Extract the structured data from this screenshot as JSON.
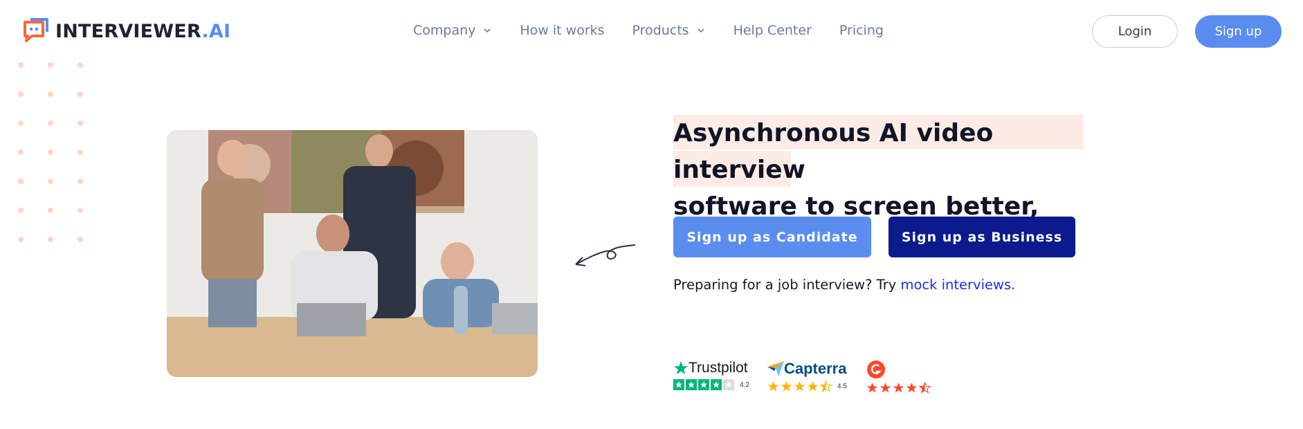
{
  "brand": {
    "name_main": "INTERVIEWER",
    "name_suffix": ".AI",
    "logo_icon": "chat-bubble-icon",
    "accent_color": "#5b8def",
    "logo_orange": "#f26a3d"
  },
  "nav": {
    "items": [
      {
        "label": "Company",
        "has_dropdown": true
      },
      {
        "label": "How it works",
        "has_dropdown": false
      },
      {
        "label": "Products",
        "has_dropdown": true
      },
      {
        "label": "Help Center",
        "has_dropdown": false
      },
      {
        "label": "Pricing",
        "has_dropdown": false
      }
    ],
    "login_label": "Login",
    "signup_label": "Sign up"
  },
  "hero": {
    "headline_line1": "Asynchronous AI video interview",
    "headline_line2_highlight": "software",
    "headline_line2_rest": " to screen better, faster.",
    "candidate_button": "Sign up as Candidate",
    "business_button": "Sign up as Business",
    "mock_prefix": "Preparing for a job interview? Try ",
    "mock_link": "mock interviews.",
    "highlight_color": "#fdece6",
    "business_color": "#0b1a8c"
  },
  "ratings": {
    "trustpilot": {
      "name": "Trustpilot",
      "score": "4.2",
      "stars": 4.2,
      "color": "#00b67a"
    },
    "capterra": {
      "name": "Capterra",
      "score": "4.5",
      "stars": 4.5,
      "color": "#ffb400"
    },
    "g2": {
      "name": "G2",
      "stars": 4.5,
      "color": "#ff492c"
    }
  }
}
